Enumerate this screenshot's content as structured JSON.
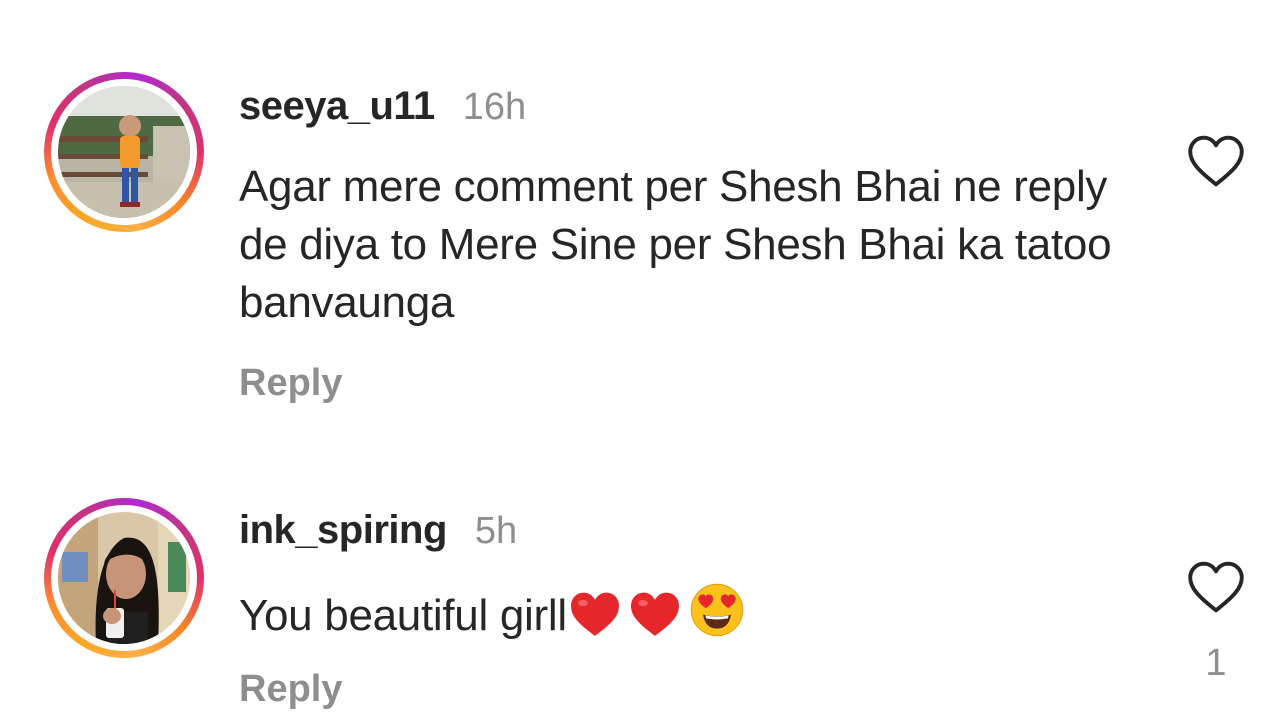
{
  "comments": [
    {
      "username": "seeya_u11",
      "time": "16h",
      "text": "Agar mere comment per Shesh Bhai ne reply de diya to Mere Sine per Shesh Bhai ka tatoo banvaunga",
      "reply_label": "Reply",
      "like_icon": "heart-outline-icon"
    },
    {
      "username": "ink_spiring",
      "time": "5h",
      "text": "You beautiful girll",
      "emojis": [
        "red-heart-emoji",
        "red-heart-emoji",
        "heart-eyes-emoji"
      ],
      "reply_label": "Reply",
      "like_icon": "heart-outline-icon",
      "like_count": "1"
    }
  ],
  "colors": {
    "text": "#262626",
    "secondary": "#8e8e8e",
    "story_ring": [
      "#f9a825",
      "#e1306c",
      "#b02ad1"
    ]
  }
}
